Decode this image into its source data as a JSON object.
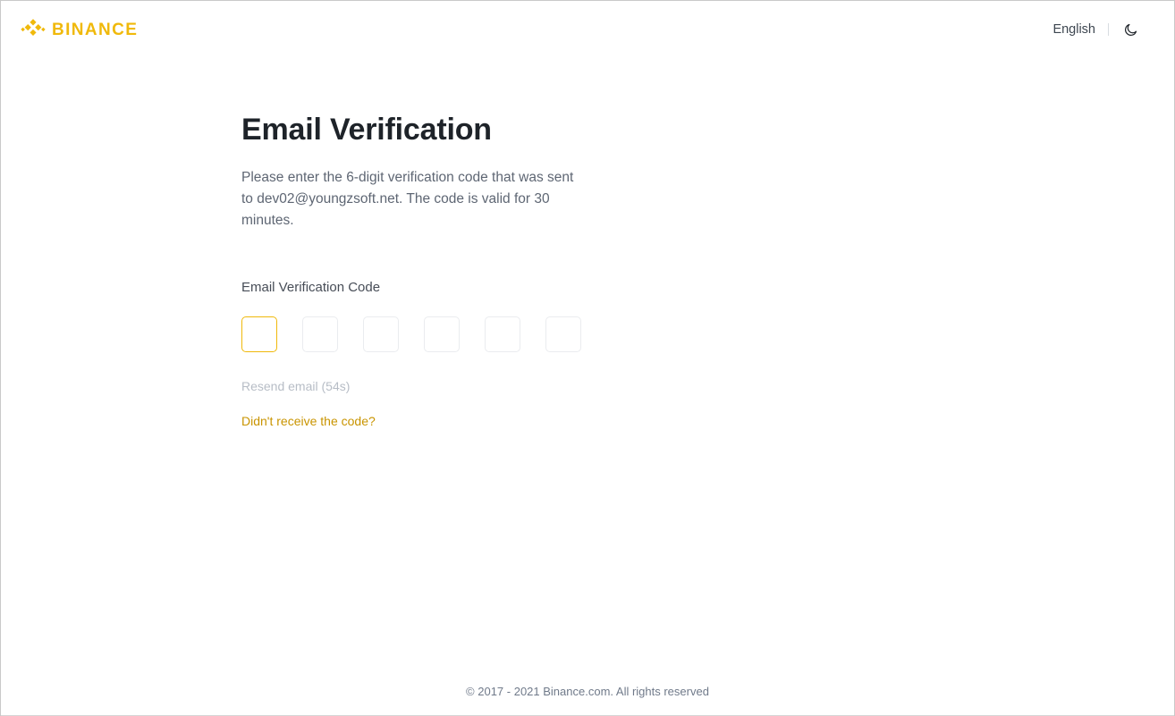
{
  "header": {
    "brand_name": "BINANCE",
    "brand_icon": "binance-diamond-logo",
    "language_label": "English",
    "theme_toggle_icon": "moon-icon",
    "brand_color": "#F0B90B"
  },
  "main": {
    "title": "Email Verification",
    "description": "Please enter the 6-digit verification code that was sent to dev02@youngzsoft.net. The code is valid for 30 minutes.",
    "field_label": "Email Verification Code",
    "code_inputs": [
      {
        "value": "",
        "focused": true
      },
      {
        "value": "",
        "focused": false
      },
      {
        "value": "",
        "focused": false
      },
      {
        "value": "",
        "focused": false
      },
      {
        "value": "",
        "focused": false
      },
      {
        "value": "",
        "focused": false
      }
    ],
    "resend_label": "Resend email (54s)",
    "resend_enabled": false,
    "help_label": "Didn't receive the code?",
    "focus_color": "#F0B90B",
    "idle_border_color": "#EAECEF",
    "help_color": "#C99400",
    "resend_color": "#B7BDC6"
  },
  "footer": {
    "copyright": "© 2017 - 2021 Binance.com. All rights reserved"
  }
}
